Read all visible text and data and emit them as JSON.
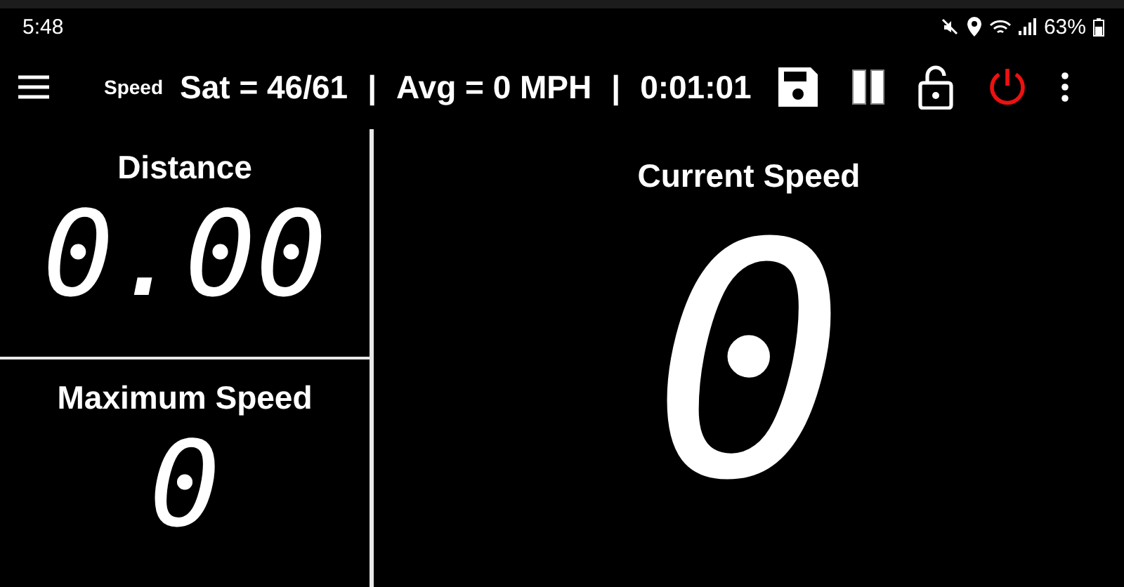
{
  "status_bar": {
    "time": "5:48",
    "battery": "63%"
  },
  "toolbar": {
    "title": "Speed",
    "sat": "Sat = 46/61",
    "separator_1": "|",
    "avg": "Avg = 0 MPH",
    "separator_2": "|",
    "elapsed": "0:01:01"
  },
  "distance": {
    "label": "Distance",
    "value": "0.00"
  },
  "maximum_speed": {
    "label": "Maximum Speed",
    "value": "0"
  },
  "current_speed": {
    "label": "Current Speed",
    "value": "0"
  }
}
